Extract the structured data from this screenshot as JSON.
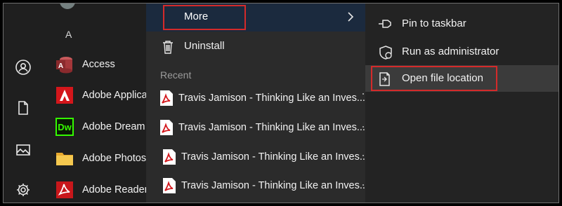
{
  "rail": {
    "items": [
      {
        "name": "user-account-icon"
      },
      {
        "name": "documents-icon"
      },
      {
        "name": "pictures-icon"
      },
      {
        "name": "settings-icon"
      }
    ]
  },
  "applist": {
    "section_letter": "A",
    "apps": [
      {
        "label": "Access",
        "icon": "access-icon",
        "color": "#a4373a"
      },
      {
        "label": "Adobe Applica",
        "icon": "adobe-app-icon",
        "color": "#e01f1f"
      },
      {
        "label": "Adobe Dream",
        "icon": "dreamweaver-icon",
        "color": "#35fa00",
        "icon_text": "Dw"
      },
      {
        "label": "Adobe Photos",
        "icon": "folder-icon",
        "color": "#f2c24e"
      },
      {
        "label": "Adobe Reader",
        "icon": "acrobat-icon",
        "color": "#e01f1f"
      }
    ]
  },
  "menu": {
    "more_label": "More",
    "uninstall_label": "Uninstall",
    "recent_header": "Recent",
    "recent_items": [
      {
        "label": "Travis Jamison - Thinking Like an Inves..."
      },
      {
        "label": "Travis Jamison - Thinking Like an Inves..."
      },
      {
        "label": "Travis Jamison - Thinking Like an Inves..."
      },
      {
        "label": "Travis Jamison - Thinking Like an Inves..."
      }
    ]
  },
  "submenu": {
    "items": [
      {
        "label": "Pin to taskbar",
        "icon": "pin-icon"
      },
      {
        "label": "Run as administrator",
        "icon": "shield-admin-icon"
      },
      {
        "label": "Open file location",
        "icon": "file-location-icon"
      }
    ]
  },
  "colors": {
    "highlight_border": "#d42a2a",
    "more_row_bg": "#1b2a3e",
    "menu_bg": "#2b2b2b"
  }
}
